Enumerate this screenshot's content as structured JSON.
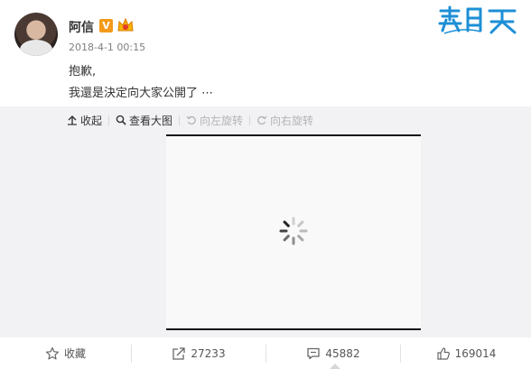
{
  "post": {
    "username": "阿信",
    "verified_badge": "V",
    "timestamp": "2018-4-1 00:15",
    "text_line1": "抱歉,",
    "text_line2": "我還是決定向大家公開了 ⋯"
  },
  "logo": {
    "icon": "mayday-logo-icon",
    "color": "#1d8fd6"
  },
  "media_toolbar": {
    "collapse": "收起",
    "view_large": "查看大图",
    "rotate_left": "向左旋转",
    "rotate_right": "向右旋转"
  },
  "media": {
    "state": "loading",
    "icon": "loading-spinner-icon"
  },
  "actions": {
    "favorite": "收藏",
    "repost_count": "27233",
    "comment_count": "45882",
    "like_count": "169014"
  },
  "colors": {
    "badge_orange": "#f39a1a",
    "media_bg": "#f2f2f5",
    "text_gray": "#808080"
  }
}
